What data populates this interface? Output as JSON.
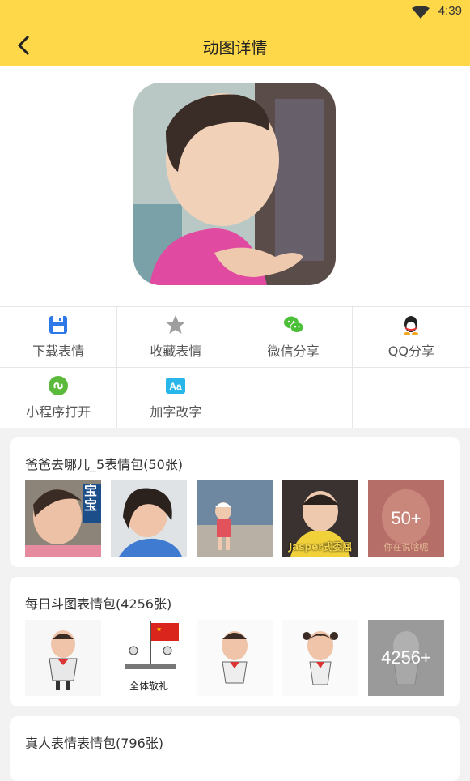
{
  "status_bar": {
    "time": "4:39"
  },
  "header": {
    "title": "动图详情"
  },
  "actions": [
    {
      "label": "下载表情",
      "icon": "save-icon"
    },
    {
      "label": "收藏表情",
      "icon": "star-icon"
    },
    {
      "label": "微信分享",
      "icon": "wechat-icon"
    },
    {
      "label": "QQ分享",
      "icon": "qq-icon"
    },
    {
      "label": "小程序打开",
      "icon": "mini-program-icon"
    },
    {
      "label": "加字改字",
      "icon": "text-edit-icon"
    }
  ],
  "packs": [
    {
      "title": "爸爸去哪儿_5表情包(50张)",
      "more": "50+",
      "thumb_captions": [
        "宝宝",
        "",
        "",
        "Jasper式委屈",
        "你在说啥呢"
      ]
    },
    {
      "title": "每日斗图表情包(4256张)",
      "more": "4256+",
      "thumb_captions": [
        "",
        "全体敬礼",
        "",
        "",
        ""
      ]
    },
    {
      "title": "真人表情表情包(796张)"
    }
  ],
  "colors": {
    "accent": "#ffd84a",
    "background": "#f2f2f2",
    "card": "#ffffff"
  }
}
